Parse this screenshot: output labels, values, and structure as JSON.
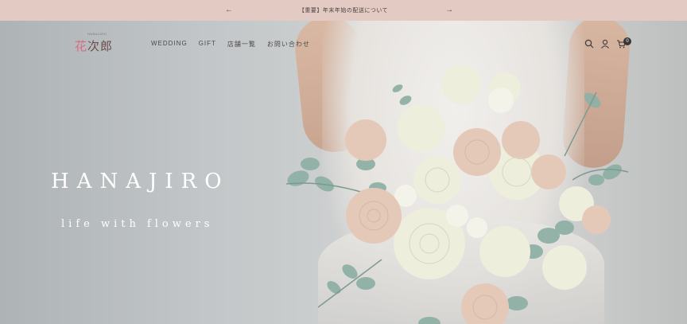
{
  "announcement": {
    "text": "【重要】年末年始の配送について",
    "prev_icon": "arrow-left-icon",
    "next_icon": "arrow-right-icon"
  },
  "header": {
    "logo_small": "HANAJIRO",
    "logo_main_hana": "花",
    "logo_main_rest": "次郎",
    "nav": [
      "WEDDING",
      "GIFT",
      "店舗一覧",
      "お問い合わせ"
    ],
    "icons": [
      "search-icon",
      "user-icon",
      "cart-icon"
    ],
    "cart_count": "0"
  },
  "hero": {
    "title": "HANAJIRO",
    "subtitle": "life with flowers"
  },
  "colors": {
    "announcement_bg": "#e3cbc3",
    "hero_text": "#ffffff",
    "logo_accent": "#d96b86"
  }
}
